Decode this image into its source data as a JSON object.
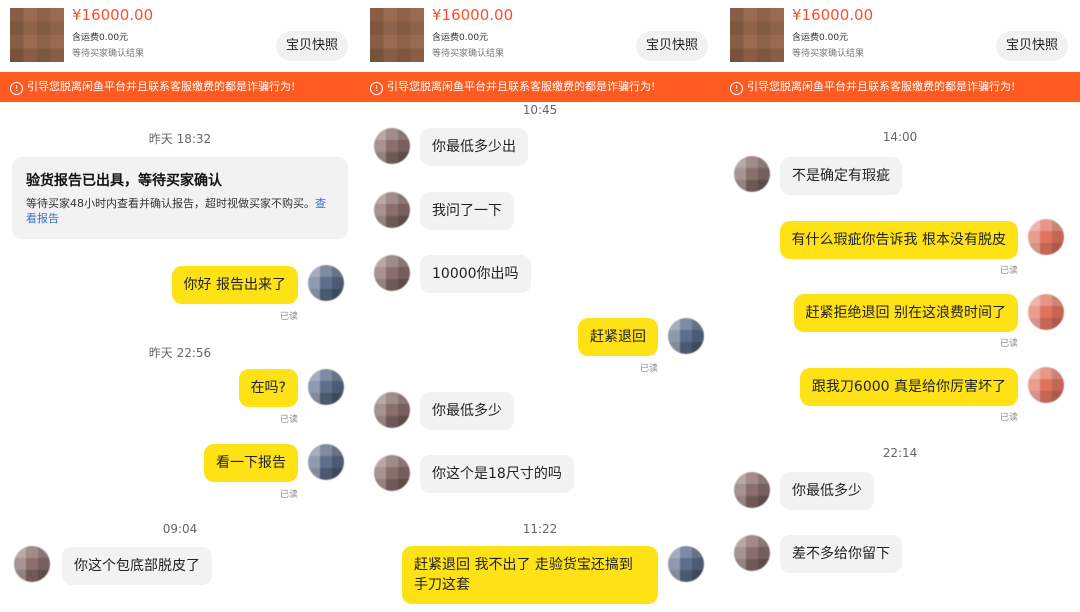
{
  "product": {
    "price": "¥16000.00",
    "shipping": "含运费0.00元",
    "status": "等待买家确认结果",
    "snapshot_button": "宝贝快照"
  },
  "warning_banner": "引导您脱离闲鱼平台并且联系客服缴费的都是诈骗行为!",
  "read_label": "已读",
  "colors": {
    "accent_orange": "#ff5a1f",
    "price_red": "#ff4f27",
    "own_bubble_yellow": "#ffe216",
    "incoming_bubble_gray": "#f2f2f2",
    "link_blue": "#3a6fcf"
  },
  "icons": {
    "warning": "info-circle-icon"
  },
  "panels": [
    {
      "timestamps": [
        "昨天 18:32",
        "昨天 22:56",
        "09:04"
      ],
      "report_card": {
        "title": "验货报告已出具，等待买家确认",
        "body": "等待买家48小时内查看并确认报告，超时视做买家不购买。",
        "link": "查看报告"
      },
      "messages": [
        {
          "side": "out",
          "text": "你好 报告出来了"
        },
        {
          "side": "out",
          "text": "在吗?"
        },
        {
          "side": "out",
          "text": "看一下报告"
        },
        {
          "side": "in",
          "text": "你这个包底部脱皮了"
        }
      ]
    },
    {
      "timestamps": [
        "10:45",
        "11:22"
      ],
      "messages": [
        {
          "side": "in",
          "text": "你最低多少出"
        },
        {
          "side": "in",
          "text": "我问了一下"
        },
        {
          "side": "in",
          "text": "10000你出吗"
        },
        {
          "side": "out",
          "text": "赶紧退回"
        },
        {
          "side": "in",
          "text": "你最低多少"
        },
        {
          "side": "in",
          "text": "你这个是18尺寸的吗"
        },
        {
          "side": "out",
          "text": "赶紧退回 我不出了 走验货宝还搞到",
          "text2": "手刀这套"
        }
      ]
    },
    {
      "timestamps": [
        "14:00",
        "22:14"
      ],
      "messages": [
        {
          "side": "in",
          "text": "不是确定有瑕疵"
        },
        {
          "side": "out",
          "text": "有什么瑕疵你告诉我 根本没有脱皮"
        },
        {
          "side": "out",
          "text": "赶紧拒绝退回 别在这浪费时间了"
        },
        {
          "side": "out",
          "text": "跟我刀6000 真是给你厉害坏了"
        },
        {
          "side": "in",
          "text": "你最低多少"
        },
        {
          "side": "in",
          "text": "差不多给你留下"
        }
      ]
    }
  ]
}
